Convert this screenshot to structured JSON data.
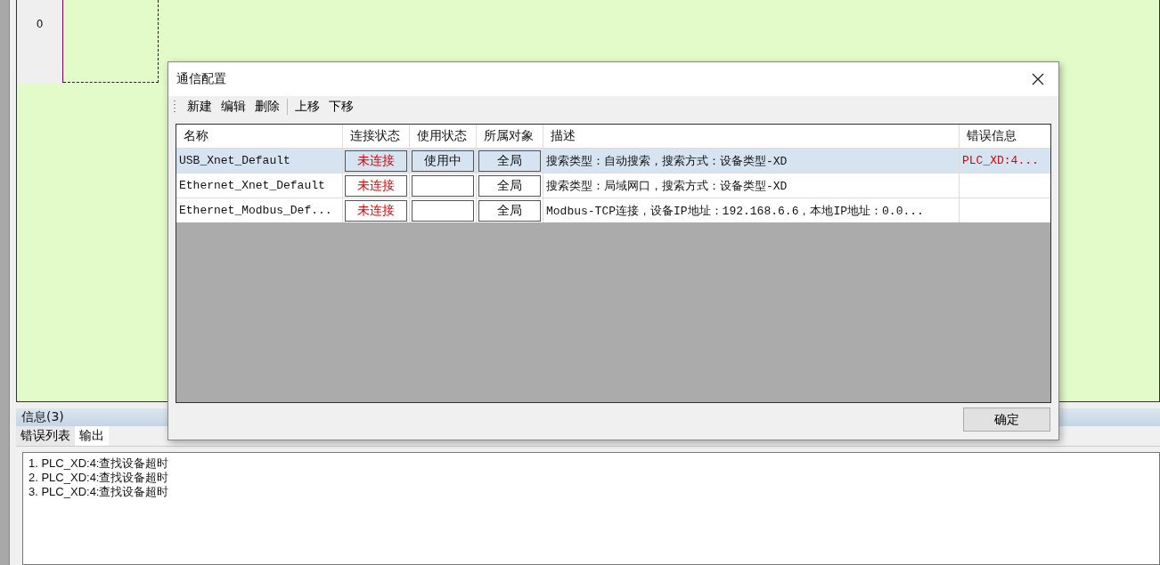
{
  "canvas": {
    "row_number": "0"
  },
  "info_panel": {
    "title": "信息(3)",
    "tabs": [
      {
        "label": "错误列表",
        "selected": false
      },
      {
        "label": "输出",
        "selected": true
      }
    ],
    "output_lines": [
      "1. PLC_XD:4:查找设备超时",
      "2. PLC_XD:4:查找设备超时",
      "3. PLC_XD:4:查找设备超时"
    ]
  },
  "dialog": {
    "title": "通信配置",
    "toolbar_groups": [
      [
        "新建",
        "编辑",
        "删除"
      ],
      [
        "上移",
        "下移"
      ]
    ],
    "table": {
      "columns": [
        "名称",
        "连接状态",
        "使用状态",
        "所属对象",
        "描述",
        "错误信息"
      ],
      "rows": [
        {
          "selected": true,
          "name": "USB_Xnet_Default",
          "connection": "未连接",
          "usage": "使用中",
          "scope": "全局",
          "description": "搜索类型：自动搜索，搜索方式：设备类型-XD",
          "error": "PLC_XD:4..."
        },
        {
          "selected": false,
          "name": "Ethernet_Xnet_Default",
          "connection": "未连接",
          "scope": "全局",
          "description": "搜索类型：局域网口，搜索方式：设备类型-XD"
        },
        {
          "selected": false,
          "name": "Ethernet_Modbus_Def...",
          "connection": "未连接",
          "scope": "全局",
          "description": "Modbus-TCP连接，设备IP地址：192.168.6.6，本地IP地址：0.0..."
        }
      ]
    },
    "ok_button": "确定"
  }
}
